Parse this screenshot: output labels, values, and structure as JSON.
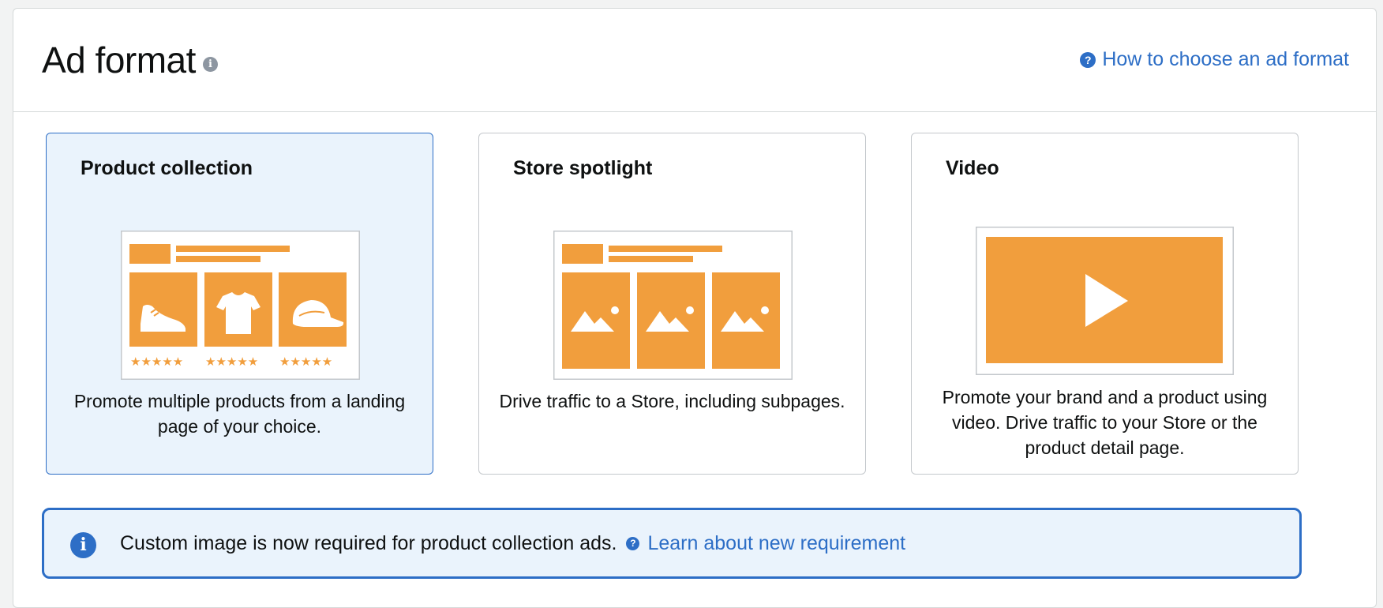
{
  "header": {
    "title": "Ad format",
    "info_icon": "info-icon",
    "help_link": "How to choose an ad format",
    "help_icon": "question-circle-icon"
  },
  "cards": [
    {
      "title": "Product collection",
      "description": "Promote multiple products from a landing page of your choice.",
      "selected": true,
      "illustration": "product-collection-illustration"
    },
    {
      "title": "Store spotlight",
      "description": "Drive traffic to a Store, including subpages.",
      "selected": false,
      "illustration": "store-spotlight-illustration"
    },
    {
      "title": "Video",
      "description": "Promote your brand and a product using video. Drive traffic to your Store or the product detail page.",
      "selected": false,
      "illustration": "video-illustration"
    }
  ],
  "notice": {
    "text": "Custom image is now required for product collection ads.",
    "link": "Learn about new requirement",
    "icon": "info-circle-icon"
  },
  "colors": {
    "accent": "#2d6ec6",
    "orange": "#f19e3d",
    "selected_bg": "#eaf3fc"
  }
}
